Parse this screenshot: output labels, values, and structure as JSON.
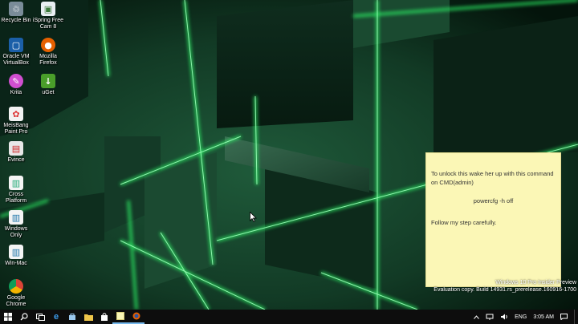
{
  "desktop": {
    "icons": [
      {
        "label": "Recycle Bin",
        "icon": "recycle-bin-icon"
      },
      {
        "label": "iSpring Free Cam 8",
        "icon": "ispring-cam-icon"
      },
      {
        "label": "Oracle VM VirtualBox",
        "icon": "virtualbox-icon"
      },
      {
        "label": "Mozilla Firefox",
        "icon": "firefox-icon"
      },
      {
        "label": "Krita",
        "icon": "krita-icon"
      },
      {
        "label": "uGet",
        "icon": "uget-icon"
      },
      {
        "label": "MeisBang Paint Pro",
        "icon": "paint-icon"
      },
      {
        "label": "Evince",
        "icon": "evince-icon"
      },
      {
        "label": "Cross Platform",
        "icon": "document-icon"
      },
      {
        "label": "Windows Only",
        "icon": "document-icon"
      },
      {
        "label": "Win-Mac",
        "icon": "document-icon"
      },
      {
        "label": "Google Chrome",
        "icon": "chrome-icon"
      }
    ]
  },
  "sticky_note": {
    "line1": "To unlock this wake her up with this command on CMD(admin)",
    "command": "powercfg -h off",
    "line2": "Follow my step carefully."
  },
  "watermark": {
    "line1": "Windows 10 Pro Insider Preview",
    "line2": "Evaluation copy. Build 14931.rs_prerelease.160916-1700"
  },
  "taskbar": {
    "buttons": [
      "start-icon",
      "search-icon",
      "task-view-icon",
      "edge-icon",
      "store-icon",
      "file-explorer-icon",
      "store-bag-icon",
      "sticky-notes-icon",
      "firefox-icon"
    ],
    "language": "ENG",
    "time": "3:05 AM"
  },
  "colors": {
    "glow": "#2dff6a",
    "sticky": "#fbf7b6",
    "taskbar": "#0d0d0d"
  }
}
